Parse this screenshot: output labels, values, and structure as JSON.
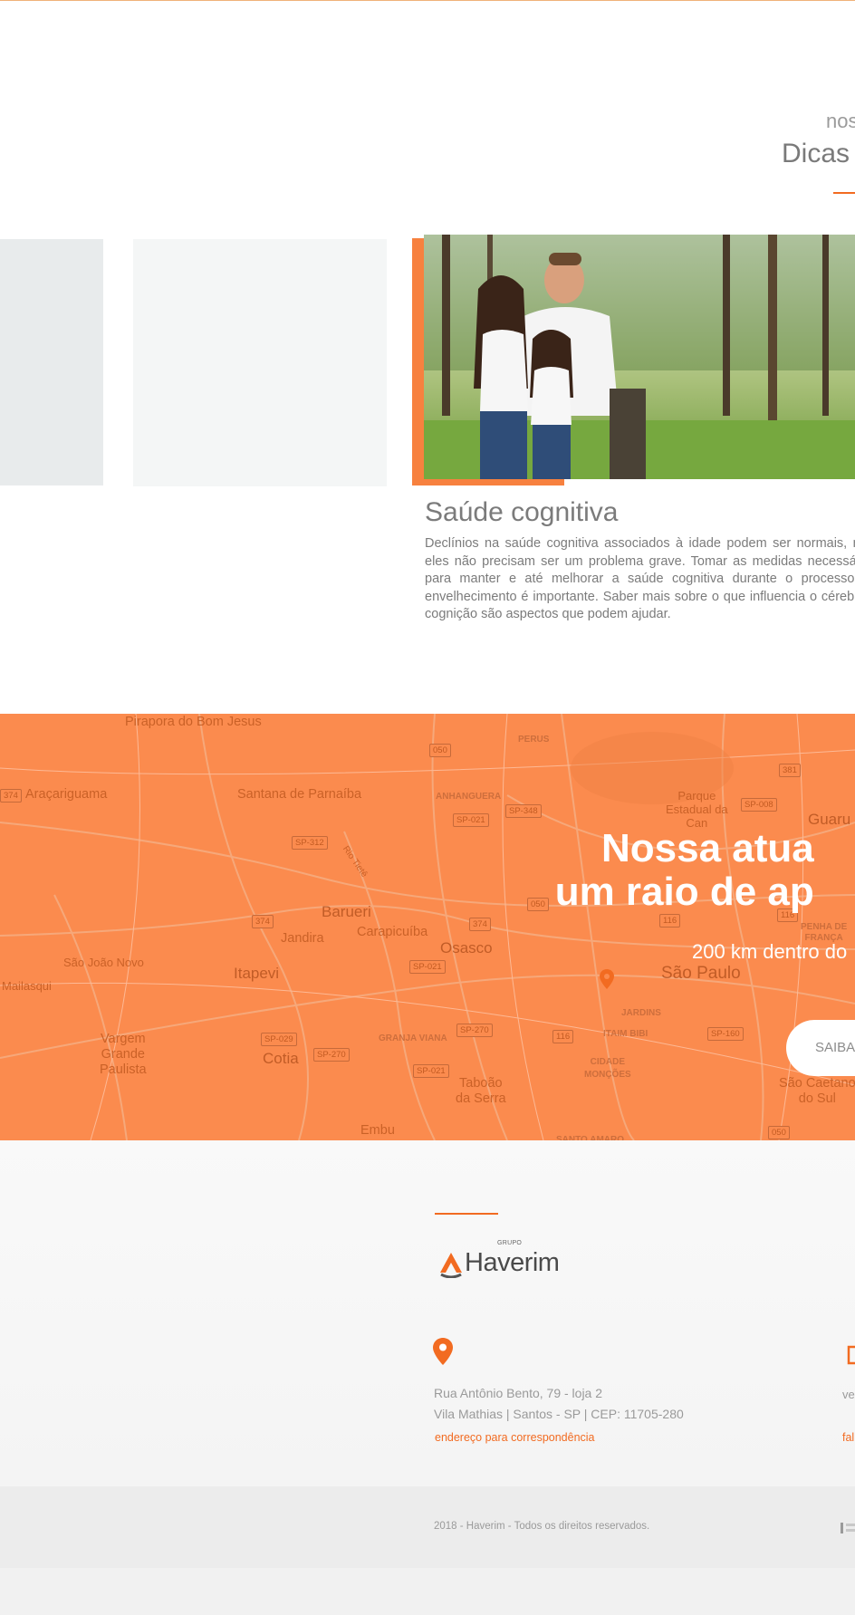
{
  "blog": {
    "eyebrow": "nos",
    "title": "Dicas d",
    "card": {
      "title": "Saúde cognitiva",
      "text": "Declínios na saúde cognitiva associados à idade podem ser normais, mas eles não precisam ser um problema grave. Tomar as medidas necessárias para manter e até melhorar a saúde cognitiva durante o processo de envelhecimento é importante. Saber mais sobre o que influencia o cérebro e cognição são aspectos que podem ajudar."
    }
  },
  "coverage": {
    "headline_line1": "Nossa atua",
    "headline_line2": "um raio de ap",
    "subtitle": "200 km dentro do",
    "button_label": "SAIBA",
    "map_labels": {
      "pirapora": "Pirapora do\nBom Jesus",
      "aracariguama": "Araçariguama",
      "santana": "Santana de\nParnaíba",
      "barueri": "Barueri",
      "jandira": "Jandira",
      "carapicuiba": "Carapicuíba",
      "osasco": "Osasco",
      "itapevi": "Itapevi",
      "sao_joao_novo": "São João Novo",
      "mailasqui": "Mailasqui",
      "vargem": "Vargem\nGrande\nPaulista",
      "cotia": "Cotia",
      "taboao": "Taboão\nda Serra",
      "embu": "Embu",
      "sao_paulo": "São Paulo",
      "jardins": "JARDINS",
      "itaim": "ITAIM BIBI",
      "cidade_moncoes": "CIDADE\nMONÇÕES",
      "sao_caetano": "São Caetano\ndo Sul",
      "guaru": "Guaru",
      "parque": "Parque\nEstadual da\nCan",
      "perus": "PERUS",
      "anhanguera": "ANHANGUERA",
      "granja_viana": "GRANJA VIANA",
      "penha": "PENHA DE\nFRANÇA",
      "santo_amaro": "SANTO AMARO",
      "rio": "Rio Tietê"
    },
    "road_badges": {
      "r050a": "050",
      "r374a": "374",
      "sp021a": "SP-021",
      "sp348": "SP-348",
      "sp312": "SP-312",
      "r050b": "050",
      "r374b": "374",
      "r374c": "374",
      "r116a": "116",
      "r116b": "116",
      "sp021b": "SP-021",
      "sp029": "SP-029",
      "sp270a": "SP-270",
      "sp270b": "SP-270",
      "r116c": "116",
      "sp021c": "SP-021",
      "sp160": "SP-160",
      "r381": "381",
      "sp008": "SP-008",
      "r050c": "050"
    },
    "colors": {
      "overlay": "#fb8b4e",
      "accent": "#f26b21"
    }
  },
  "footer": {
    "logo_group": "GRUPO",
    "logo_word": "Haverim",
    "address_line1": "Rua Antônio Bento, 79 - loja 2",
    "address_line2": "Vila Mathias | Santos - SP | CEP: 11705-280",
    "address_link": "endereço para correspondência",
    "contact_fragment": "ve",
    "contact_link_fragment": "fal",
    "copyright": "2018 -  Haverim - Todos os direitos reservados.",
    "icons": {
      "location": "map-pin-icon",
      "email": "envelope-icon"
    }
  }
}
